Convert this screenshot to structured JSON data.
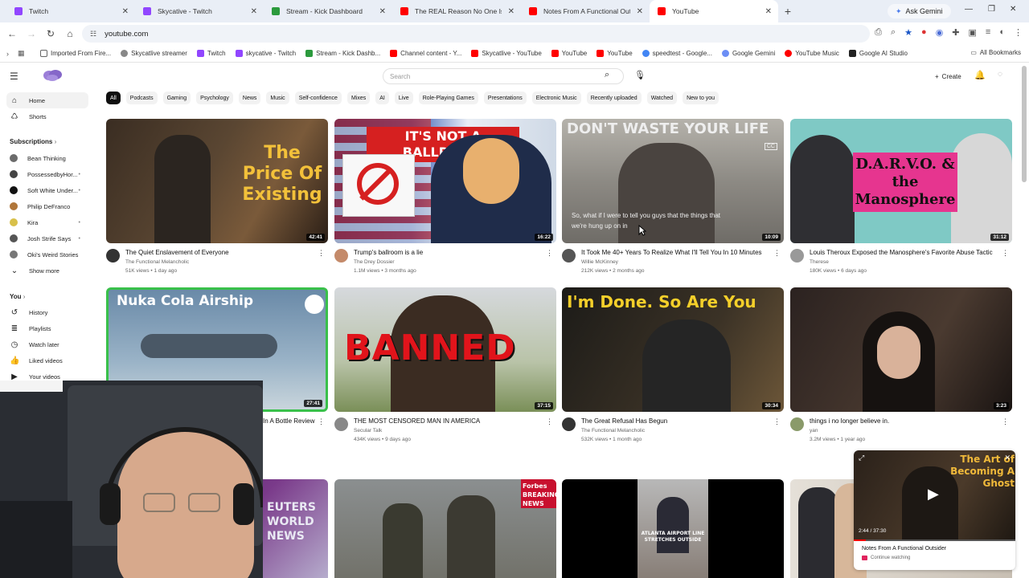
{
  "browser": {
    "tabs": [
      {
        "title": "Twitch",
        "color": "#9146ff"
      },
      {
        "title": "Skycative - Twitch",
        "color": "#9146ff"
      },
      {
        "title": "Stream - Kick Dashboard",
        "color": "#2b9a3d"
      },
      {
        "title": "The REAL Reason No One Is Sh",
        "color": "#ff0000"
      },
      {
        "title": "Notes From A Functional Outsi",
        "color": "#ff0000"
      },
      {
        "title": "YouTube",
        "color": "#ff0000"
      }
    ],
    "ask_gemini": "Ask Gemini",
    "url": "youtube.com",
    "bookmarks": [
      {
        "label": "Imported From Fire...",
        "icon": "folder-icon"
      },
      {
        "label": "Skycatlive streamer",
        "icon": "globe-icon"
      },
      {
        "label": "Twitch",
        "icon": "twitch-icon"
      },
      {
        "label": "skycative - Twitch",
        "icon": "twitch-icon"
      },
      {
        "label": "Stream - Kick Dashb...",
        "icon": "kick-icon"
      },
      {
        "label": "Channel content - Y...",
        "icon": "youtube-icon"
      },
      {
        "label": "Skycatlive - YouTube",
        "icon": "youtube-icon"
      },
      {
        "label": "YouTube",
        "icon": "youtube-icon"
      },
      {
        "label": "YouTube",
        "icon": "youtube-icon"
      },
      {
        "label": "speedtest - Google...",
        "icon": "google-icon"
      },
      {
        "label": "Google Gemini",
        "icon": "gemini-icon"
      },
      {
        "label": "YouTube Music",
        "icon": "youtube-music-icon"
      },
      {
        "label": "Google AI Studio",
        "icon": "ai-studio-icon"
      }
    ],
    "all_bookmarks": "All Bookmarks"
  },
  "yt": {
    "search_placeholder": "Search",
    "create_label": "Create",
    "sidebar": {
      "home": "Home",
      "shorts": "Shorts",
      "subscriptions_header": "Subscriptions",
      "subscriptions": [
        {
          "name": "Bean Thinking",
          "color": "#6b6b6b"
        },
        {
          "name": "PossessedbyHor...",
          "color": "#444"
        },
        {
          "name": "Soft White Under...",
          "color": "#111"
        },
        {
          "name": "Philip DeFranco",
          "color": "#b0763a"
        },
        {
          "name": "Kira",
          "color": "#d8c04a"
        },
        {
          "name": "Josh Strife Says",
          "color": "#555"
        },
        {
          "name": "Oki's Weird Stories",
          "color": "#777"
        }
      ],
      "show_more": "Show more",
      "you_header": "You",
      "you_items": [
        "History",
        "Playlists",
        "Watch later",
        "Liked videos",
        "Your videos"
      ]
    },
    "chips": [
      "All",
      "Podcasts",
      "Gaming",
      "Psychology",
      "News",
      "Music",
      "Self-confidence",
      "Mixes",
      "AI",
      "Live",
      "Role-Playing Games",
      "Presentations",
      "Electronic Music",
      "Recently uploaded",
      "Watched",
      "New to you"
    ],
    "videos": [
      {
        "title": "The Quiet Enslavement of Everyone",
        "channel": "The Functional Melancholic",
        "stats": "51K views • 1 day ago",
        "duration": "42:41",
        "thumb_text": "The Price Of Existing"
      },
      {
        "title": "Trump's ballroom is a lie",
        "channel": "The Drey Dossier",
        "stats": "1.1M views • 3 months ago",
        "duration": "16:22",
        "thumb_text": "IT'S NOT A BALLROOM"
      },
      {
        "title": "It Took Me 40+ Years To Realize What I'll Tell You In 10 Minutes",
        "channel": "Willie McKinney",
        "stats": "212K views • 2 months ago",
        "duration": "10:09",
        "thumb_text": "DON'T WASTE YOUR LIFE",
        "caption": "So, what if I were to tell you guys that the things that we're hung up on in"
      },
      {
        "title": "Louis Theroux Exposed the Manosphere's Favorite Abuse Tactic",
        "channel": "Therese",
        "stats": "180K views • 6 days ago",
        "duration": "31:12",
        "thumb_text": "D.A.R.V.O. & the Manosphere"
      },
      {
        "title": "In A Bottle Review",
        "channel": "",
        "stats": "",
        "duration": "27:41",
        "thumb_text": "Nuka Cola Airship"
      },
      {
        "title": "THE MOST CENSORED MAN IN AMERICA",
        "channel": "Secular Talk",
        "stats": "434K views • 9 days ago",
        "duration": "37:15",
        "thumb_text": "BANNED"
      },
      {
        "title": "The Great Refusal Has Begun",
        "channel": "The Functional Melancholic",
        "stats": "532K views • 1 month ago",
        "duration": "30:34",
        "thumb_text": "I'm Done. So Are You"
      },
      {
        "title": "things i no longer believe in.",
        "channel": "yan",
        "stats": "3.2M views • 1 year ago",
        "duration": "3:23",
        "thumb_text": ""
      }
    ],
    "row3_labels": [
      "EUTERS WORLD NEWS",
      "Forbes BREAKING NEWS",
      "ATLANTA AIRPORT LINE STRETCHES OUTSIDE",
      ""
    ],
    "miniplayer": {
      "time": "2:44 / 37:30",
      "title": "Notes From A Functional Outsider",
      "status": "Continue watching",
      "thumb_text": "The Art of Becoming A Ghost"
    }
  }
}
